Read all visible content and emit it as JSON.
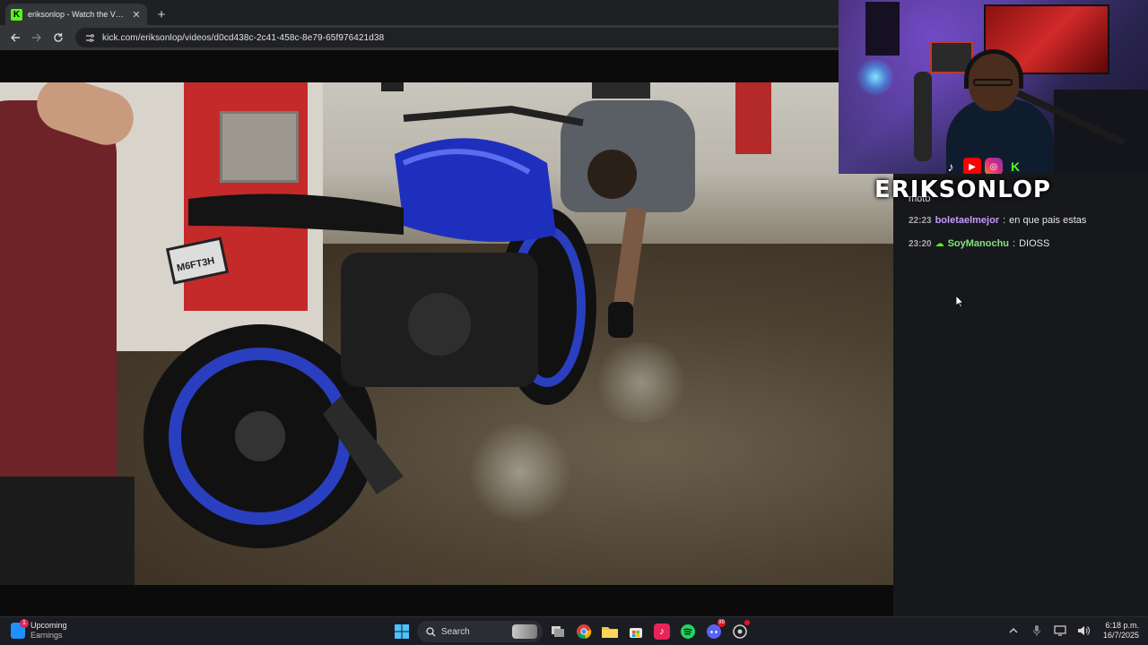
{
  "browser": {
    "tab_title": "eriksonlop - Watch the VOD on Kick",
    "favicon_letter": "K",
    "new_tab_label": "+",
    "url": "kick.com/eriksonlop/videos/d0cd438c-2c41-458c-8e79-65f976421d38"
  },
  "video": {
    "plate_text": "M6FT3H"
  },
  "stream_overlay": {
    "streamer_name": "ERIKSONLOP",
    "social_icons": [
      "tiktok-icon",
      "youtube-icon",
      "instagram-icon",
      "kick-icon"
    ]
  },
  "chat": {
    "partial_message": "moto",
    "messages": [
      {
        "time": "22:23",
        "user": "boletaelmejor",
        "user_color": "#c39bff",
        "badge": "",
        "text": "en que pais estas"
      },
      {
        "time": "23:20",
        "user": "SoyManochu",
        "user_color": "#7fe27f",
        "badge": "☁",
        "text": "DIOSS"
      }
    ]
  },
  "taskbar": {
    "widget_title": "Upcoming",
    "widget_sub": "Earnings",
    "widget_badge": "1",
    "search_label": "Search",
    "discord_badge": "99",
    "time": "6:18 p.m.",
    "date": "16/7/2025"
  },
  "colors": {
    "kick_green": "#53fc18",
    "chat_bg": "#17181b",
    "taskbar_bg": "#1c1d22"
  }
}
